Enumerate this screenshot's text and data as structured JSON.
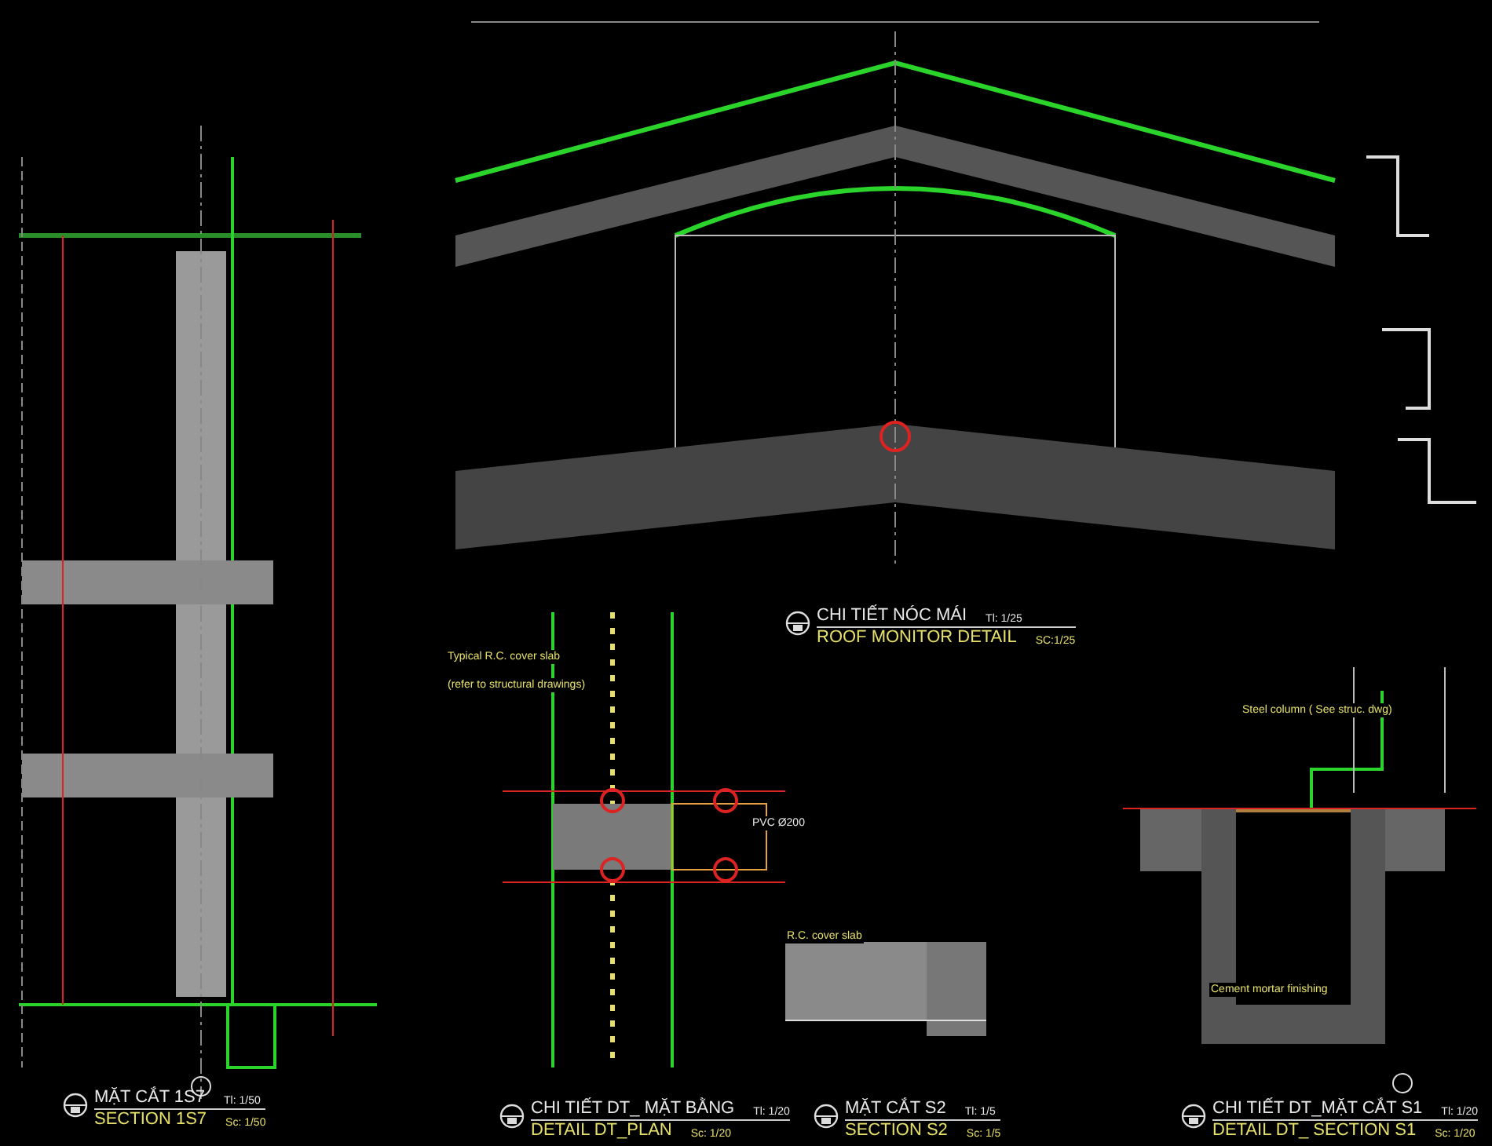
{
  "details": [
    {
      "title_vi": "MẶT CẮT 1S7",
      "title_en": "SECTION 1S7",
      "scale_vi": "Tl: 1/50",
      "scale_en": "Sc: 1/50"
    },
    {
      "title_vi": "CHI TIẾT NÓC MÁI",
      "title_en": "ROOF MONITOR DETAIL",
      "scale_vi": "Tl: 1/25",
      "scale_en": "SC:1/25"
    },
    {
      "title_vi": "CHI TIẾT DT_ MẶT BẰNG",
      "title_en": "DETAIL DT_PLAN",
      "scale_vi": "Tl: 1/20",
      "scale_en": "Sc: 1/20"
    },
    {
      "title_vi": "MẶT CẮT S2",
      "title_en": "SECTION S2",
      "scale_vi": "Tl: 1/5",
      "scale_en": "Sc: 1/5"
    },
    {
      "title_vi": "CHI TIẾT DT_MẶT CẮT S1",
      "title_en": "DETAIL DT_ SECTION S1",
      "scale_vi": "Tl: 1/20",
      "scale_en": "Sc: 1/20"
    }
  ],
  "annotations": [
    {
      "text": "Typical R.C. cover slab",
      "kind": "en"
    },
    {
      "text": "(refer to structural drawings)",
      "kind": "en"
    },
    {
      "text": "PVC Ø200",
      "kind": "vi"
    },
    {
      "text": "Steel column ( See struc. dwg)",
      "kind": "en"
    },
    {
      "text": "Cement mortar finishing",
      "kind": "en"
    },
    {
      "text": "R.C. cover slab",
      "kind": "en"
    }
  ]
}
